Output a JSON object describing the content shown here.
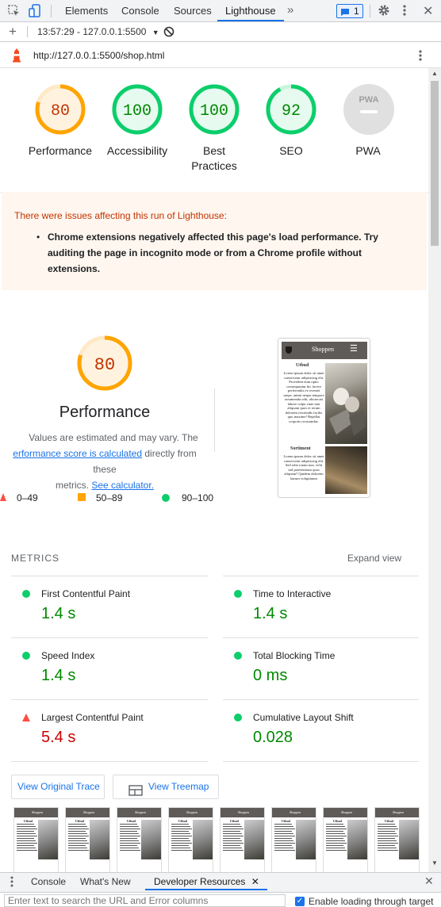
{
  "devtools": {
    "tabs": [
      "Elements",
      "Console",
      "Sources",
      "Lighthouse"
    ],
    "active_tab": "Lighthouse",
    "issues_count": "1"
  },
  "lighthouse_toolbar": {
    "report_label": "13:57:29 - 127.0.0.1:5500"
  },
  "url_bar": {
    "url": "http://127.0.0.1:5500/shop.html"
  },
  "summary": {
    "scores": [
      {
        "label": "Performance",
        "value": "80",
        "level": 0.8,
        "color": "#ffa400"
      },
      {
        "label": "Accessibility",
        "value": "100",
        "level": 1.0,
        "color": "#0cce6b"
      },
      {
        "label": "Best",
        "label2": "Practices",
        "value": "100",
        "level": 1.0,
        "color": "#0cce6b"
      },
      {
        "label": "SEO",
        "value": "92",
        "level": 0.92,
        "color": "#0cce6b"
      },
      {
        "label": "PWA",
        "value": "PWA",
        "level": 0,
        "color": "#9e9e9e"
      }
    ]
  },
  "warning": {
    "title": "There were issues affecting this run of Lighthouse:",
    "items": [
      "Chrome extensions negatively affected this page's load performance. Try auditing the page in incognito mode or from a Chrome profile without extensions."
    ]
  },
  "performance": {
    "score": "80",
    "level": 0.8,
    "title": "Performance",
    "note_part1": "Values are estimated and may vary. The",
    "note_link1": "erformance score is calculated",
    "note_part2": "directly from these",
    "note_part3": "metrics.",
    "note_link2": "See calculator.",
    "legend": [
      {
        "range": "0–49",
        "shape": "triangle",
        "color": "#ff4e42"
      },
      {
        "range": "50–89",
        "shape": "square",
        "color": "#ffa400"
      },
      {
        "range": "90–100",
        "shape": "circle",
        "color": "#0cce6b"
      }
    ]
  },
  "preview": {
    "header": "Shoppen",
    "heading1": "Utbud",
    "body1": "Lorem ipsum dolor sit amet consectetur adipisicing elit. Provident eum optio consequuntur hic facere perferendis ex eveniet saepe, animi neque tempore assumenda odit, obcaecati labore culpa vitae non aliquam quos et rerum dolorem reiciendis facilis quo maxime! Repellat corporis recusandae.",
    "heading2": "Sortiment",
    "body2": "Lorem ipsum dolor sit amet consectetur adipisicing elit. Sed odio totam non, velit sed praesentium quos aliquam? Quidem dolorem harum voluptatum"
  },
  "metrics": {
    "label": "METRICS",
    "expand": "Expand view",
    "items": [
      {
        "title": "First Contentful Paint",
        "value": "1.4 s",
        "status": "pass"
      },
      {
        "title": "Time to Interactive",
        "value": "1.4 s",
        "status": "pass"
      },
      {
        "title": "Speed Index",
        "value": "1.4 s",
        "status": "pass"
      },
      {
        "title": "Total Blocking Time",
        "value": "0 ms",
        "status": "pass"
      },
      {
        "title": "Largest Contentful Paint",
        "value": "5.4 s",
        "status": "fail"
      },
      {
        "title": "Cumulative Layout Shift",
        "value": "0.028",
        "status": "pass"
      }
    ]
  },
  "buttons": {
    "view_trace": "View Original Trace",
    "view_treemap": "View Treemap"
  },
  "filmstrip": {
    "frames": 8,
    "header": "Shoppen",
    "heading": "Utbud"
  },
  "drawer": {
    "tabs": [
      "Console",
      "What's New",
      "Developer Resources"
    ],
    "active_tab": "Developer Resources",
    "search_placeholder": "Enter text to search the URL and Error columns",
    "checkbox_label": "Enable loading through target"
  },
  "colors": {
    "pass": "#008800",
    "fail": "#cc0000",
    "average": "#c33300",
    "link": "#1a73e8"
  }
}
